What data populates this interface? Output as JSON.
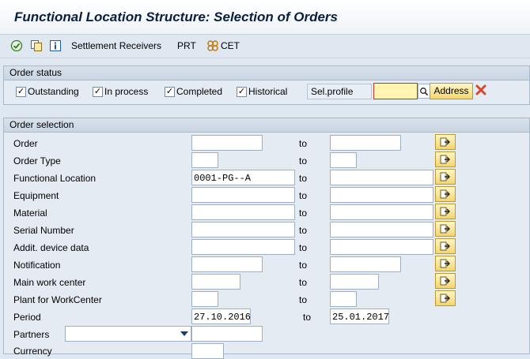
{
  "window": {
    "title": "Functional Location Structure: Selection of Orders"
  },
  "toolbar": {
    "execute_icon": "execute-icon",
    "copy_icon": "copy-variant-icon",
    "info_icon": "info-icon",
    "settlement_receivers": "Settlement Receivers",
    "prt": "PRT",
    "cet_icon": "cet-icon",
    "cet": "CET"
  },
  "order_status": {
    "heading": "Order status",
    "checkboxes": [
      {
        "label": "Outstanding",
        "checked": true
      },
      {
        "label": "In process",
        "checked": true
      },
      {
        "label": "Completed",
        "checked": true
      },
      {
        "label": "Historical",
        "checked": true
      }
    ],
    "sel_profile_label": "Sel.profile",
    "sel_profile_value": "",
    "address_button": "Address",
    "delete_icon": "delete-icon"
  },
  "order_selection": {
    "heading": "Order selection",
    "to_label": "to",
    "rows": [
      {
        "label": "Order",
        "from": "",
        "to": ""
      },
      {
        "label": "Order Type",
        "from": "",
        "to": ""
      },
      {
        "label": "Functional Location",
        "from": "0001-PG--A",
        "to": ""
      },
      {
        "label": "Equipment",
        "from": "",
        "to": ""
      },
      {
        "label": "Material",
        "from": "",
        "to": ""
      },
      {
        "label": "Serial Number",
        "from": "",
        "to": ""
      },
      {
        "label": "Addit. device data",
        "from": "",
        "to": ""
      },
      {
        "label": "Notification",
        "from": "",
        "to": ""
      },
      {
        "label": "Main work center",
        "from": "",
        "to": ""
      },
      {
        "label": "Plant for WorkCenter",
        "from": "",
        "to": ""
      }
    ],
    "period": {
      "label": "Period",
      "from": "27.10.2016",
      "to_label": "to",
      "to": "25.01.2017"
    },
    "partners": {
      "label": "Partners",
      "select_value": "",
      "value": ""
    },
    "currency": {
      "label": "Currency",
      "value": ""
    }
  },
  "colors": {
    "accent_button": "#f2d66f",
    "required_field": "#fff4b0",
    "delete": "#d9472b"
  }
}
